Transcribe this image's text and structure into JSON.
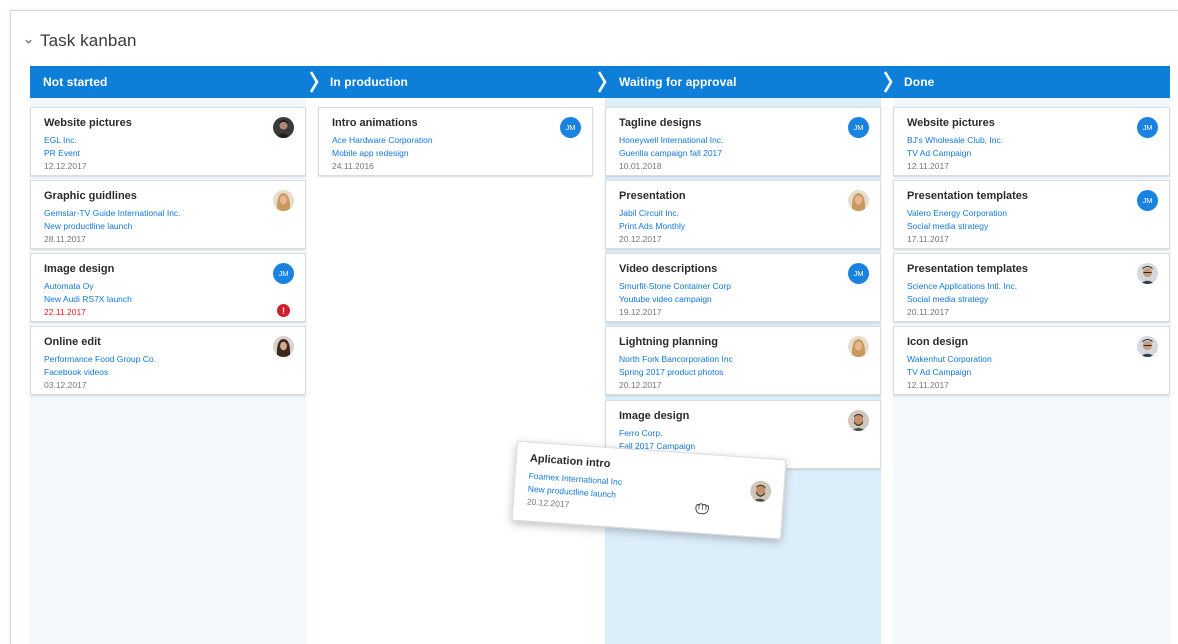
{
  "section": {
    "title": "Task kanban"
  },
  "colors": {
    "header": "#0e7fd8",
    "column_bg": "#f3f8fd",
    "highlight_bg": "#ddeefb",
    "link": "#1178d6",
    "overdue": "#e02020"
  },
  "columns": [
    {
      "title": "Not started",
      "cards": [
        {
          "title": "Website pictures",
          "company": "EGL Inc.",
          "project": "PR Event",
          "date": "12.12.2017",
          "avatar": "avatar-dark-man"
        },
        {
          "title": "Graphic guidlines",
          "company": "Gemstar-TV Guide International Inc.",
          "project": "New productline launch",
          "date": "28.11.2017",
          "avatar": "avatar-blonde-woman"
        },
        {
          "title": "Image design",
          "company": "Automata Oy",
          "project": "New Audi RS7X launch",
          "date": "22.11.2017",
          "avatar": "JM",
          "overdue": true,
          "alert_icon": "exclamation-icon"
        },
        {
          "title": "Online edit",
          "company": "Performance Food Group Co.",
          "project": "Facebook videos",
          "date": "03.12.2017",
          "avatar": "avatar-brunette-woman"
        }
      ]
    },
    {
      "title": "In production",
      "cards": [
        {
          "title": "Intro animations",
          "company": "Ace Hardware Corporation",
          "project": "Mobile app redesign",
          "date": "24.11.2016",
          "avatar": "JM"
        }
      ]
    },
    {
      "title": "Waiting for approval",
      "cards": [
        {
          "title": "Tagline designs",
          "company": "Honeywell International Inc.",
          "project": "Guerilla campaign fall 2017",
          "date": "10.01.2018",
          "avatar": "JM"
        },
        {
          "title": "Presentation",
          "company": "Jabil Circuit Inc.",
          "project": "Print Ads Monthly",
          "date": "20.12.2017",
          "avatar": "avatar-blonde-woman"
        },
        {
          "title": "Video descriptions",
          "company": "Smurfit-Stone Container Corp",
          "project": "Youtube video campaign",
          "date": "19.12.2017",
          "avatar": "JM"
        },
        {
          "title": "Lightning planning",
          "company": "North Fork Bancorporation Inc",
          "project": "Spring 2017 product photos",
          "date": "20.12.2017",
          "avatar": "avatar-blonde-woman"
        },
        {
          "title": "Image design",
          "company": "Ferro Corp.",
          "project": "Fall 2017 Campaign",
          "date": "",
          "avatar": "avatar-bearded-man"
        }
      ]
    },
    {
      "title": "Done",
      "cards": [
        {
          "title": "Website pictures",
          "company": "BJ's Wholesale Club, Inc.",
          "project": "TV Ad Campaign",
          "date": "12.11.2017",
          "avatar": "JM"
        },
        {
          "title": "Presentation templates",
          "company": "Valero Energy Corporation",
          "project": "Social media strategy",
          "date": "17.11.2017",
          "avatar": "JM"
        },
        {
          "title": "Presentation templates",
          "company": "Science Applications Intl. Inc.",
          "project": "Social media strategy",
          "date": "20.11.2017",
          "avatar": "avatar-man-glasses"
        },
        {
          "title": "Icon design",
          "company": "Wakenhut Corporation",
          "project": "TV Ad Campaign",
          "date": "12.11.2017",
          "avatar": "avatar-man-glasses"
        }
      ]
    }
  ],
  "dragging_card": {
    "title": "Aplication intro",
    "company": "Foamex International Inc",
    "project": "New productline launch",
    "date": "20.12.2017",
    "avatar": "avatar-bearded-man",
    "cursor_icon": "grab-hand-icon"
  }
}
